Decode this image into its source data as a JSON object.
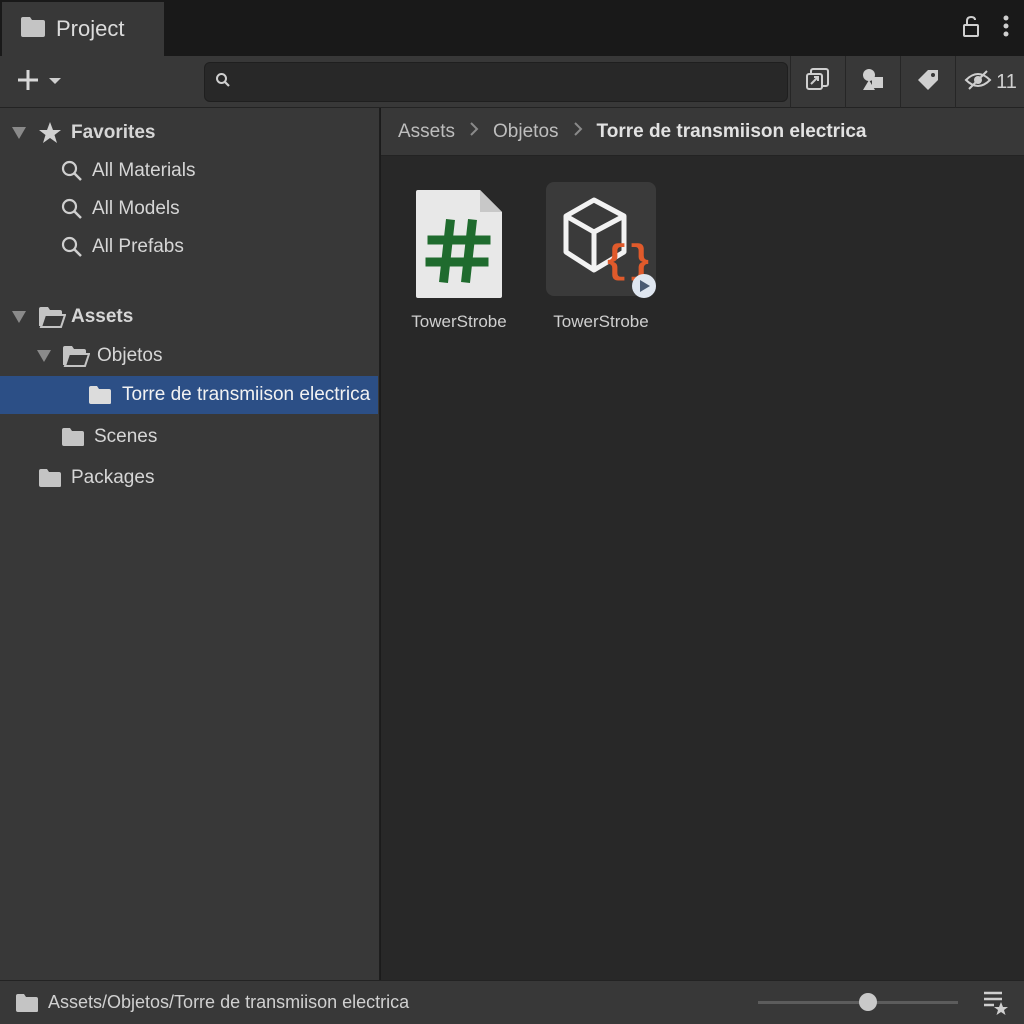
{
  "window": {
    "tab_title": "Project",
    "lock_icon": "lock-icon",
    "menu_icon": "kebab-menu-icon"
  },
  "toolbar": {
    "add_icon": "plus-icon",
    "search_placeholder": "",
    "search_value": "",
    "hidden_count": "11"
  },
  "tree": {
    "favorites": {
      "label": "Favorites",
      "items": [
        "All Materials",
        "All Models",
        "All Prefabs"
      ]
    },
    "assets": {
      "label": "Assets",
      "objetos": "Objetos",
      "selected": "Torre de transmiison electrica",
      "scenes": "Scenes"
    },
    "packages": "Packages"
  },
  "breadcrumb": [
    "Assets",
    "Objetos",
    "Torre de transmiison electrica"
  ],
  "assets": [
    {
      "name": "TowerStrobe",
      "type": "csharp-script",
      "icon": "csharp-script-icon"
    },
    {
      "name": "TowerStrobe",
      "type": "prefab-variant",
      "icon": "prefab-script-icon"
    }
  ],
  "status": {
    "path": "Assets/Objetos/Torre de transmiison electrica",
    "zoom_level": 0.55
  },
  "colors": {
    "selection": "#2c4f86",
    "panel": "#383838",
    "content": "#282828",
    "script_hash": "#1f6b2e",
    "json_brace": "#e05a2b"
  }
}
